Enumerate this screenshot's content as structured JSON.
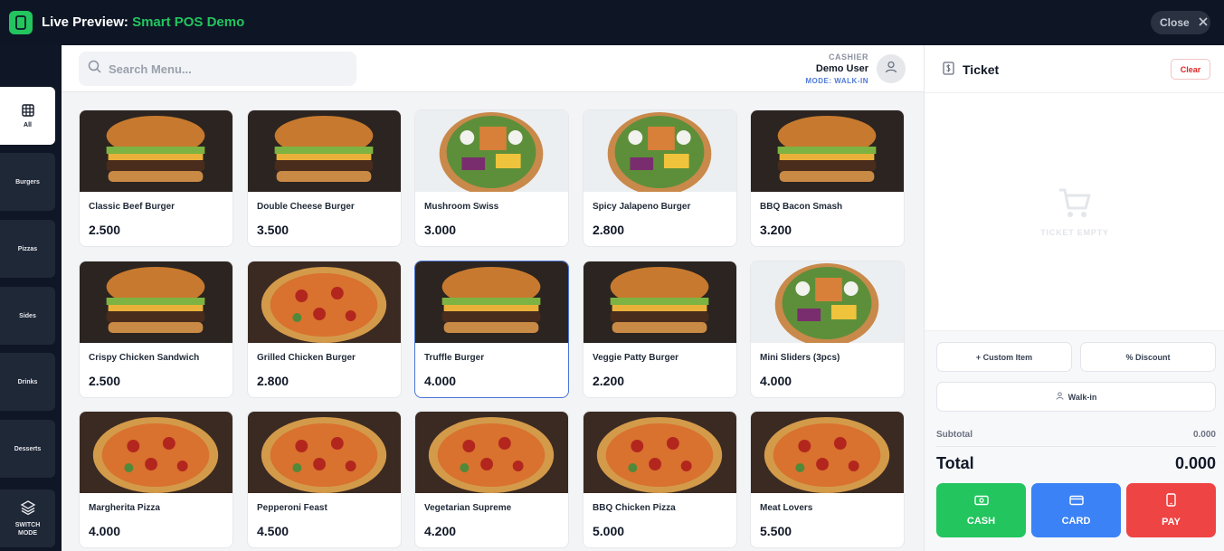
{
  "window": {
    "title_prefix": "Live Preview:",
    "title_name": "Smart POS Demo",
    "close_label": "Close"
  },
  "categories": [
    {
      "label": "All",
      "icon": "grid-icon",
      "active": true
    },
    {
      "label": "Burgers"
    },
    {
      "label": "Pizzas"
    },
    {
      "label": "Sides"
    },
    {
      "label": "Drinks"
    },
    {
      "label": "Desserts"
    },
    {
      "label": "SWITCH MODE",
      "icon": "layers-icon"
    }
  ],
  "search": {
    "placeholder": "Search Menu..."
  },
  "cashier": {
    "role": "CASHIER",
    "name": "Demo User",
    "mode": "MODE: WALK-IN"
  },
  "products": [
    {
      "name": "Classic Beef Burger",
      "price": "2.500",
      "image": "burger-photo"
    },
    {
      "name": "Double Cheese Burger",
      "price": "3.500",
      "image": "burger-photo"
    },
    {
      "name": "Mushroom Swiss",
      "price": "3.000",
      "image": "salad-bowl-photo"
    },
    {
      "name": "Spicy Jalapeno Burger",
      "price": "2.800",
      "image": "salad-bowl-photo"
    },
    {
      "name": "BBQ Bacon Smash",
      "price": "3.200",
      "image": "burger-photo"
    },
    {
      "name": "Crispy Chicken Sandwich",
      "price": "2.500",
      "image": "burger-photo"
    },
    {
      "name": "Grilled Chicken Burger",
      "price": "2.800",
      "image": "pizza-photo"
    },
    {
      "name": "Truffle Burger",
      "price": "4.000",
      "image": "burger-photo",
      "selected": true
    },
    {
      "name": "Veggie Patty Burger",
      "price": "2.200",
      "image": "burger-photo"
    },
    {
      "name": "Mini Sliders (3pcs)",
      "price": "4.000",
      "image": "salad-bowl-photo"
    },
    {
      "name": "Margherita Pizza",
      "price": "4.000",
      "image": "pizza-photo"
    },
    {
      "name": "Pepperoni Feast",
      "price": "4.500",
      "image": "pizza-photo"
    },
    {
      "name": "Vegetarian Supreme",
      "price": "4.200",
      "image": "pizza-photo"
    },
    {
      "name": "BBQ Chicken Pizza",
      "price": "5.000",
      "image": "pizza-photo"
    },
    {
      "name": "Meat Lovers",
      "price": "5.500",
      "image": "pizza-photo"
    }
  ],
  "ticket": {
    "title": "Ticket",
    "clear_label": "Clear",
    "empty_text": "TICKET EMPTY",
    "custom_item_label": "+ Custom Item",
    "discount_label": "% Discount",
    "customer_label": "Walk-in",
    "subtotal_label": "Subtotal",
    "subtotal_value": "0.000",
    "total_label": "Total",
    "total_value": "0.000",
    "pay_buttons": [
      {
        "label": "CASH",
        "icon": "cash-icon",
        "color": "#22c55e"
      },
      {
        "label": "CARD",
        "icon": "card-icon",
        "color": "#3b82f6"
      },
      {
        "label": "PAY",
        "icon": "phone-icon",
        "color": "#ef4444"
      }
    ]
  },
  "colors": {
    "accent": "#22c55e",
    "topbar": "#0e1626",
    "selected_border": "#4a74d8",
    "mode_text": "#4f7bd9",
    "danger": "#dc2626"
  }
}
